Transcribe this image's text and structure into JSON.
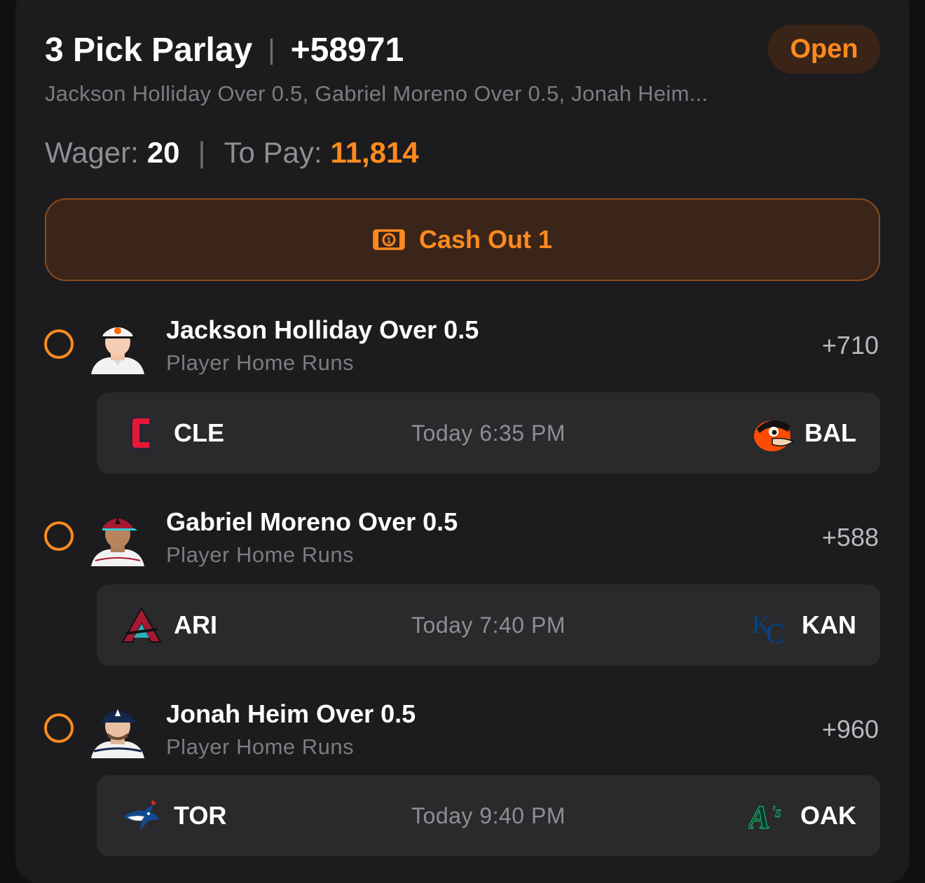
{
  "parlay": {
    "title": "3 Pick Parlay",
    "separator": "|",
    "odds": "+58971",
    "status": "Open",
    "picks_summary": "Jackson Holliday Over 0.5, Gabriel Moreno Over 0.5, Jonah Heim...",
    "wager_label": "Wager:",
    "wager_value": "20",
    "to_pay_label": "To Pay:",
    "to_pay_value": "11,814",
    "cash_out_label": "Cash Out 1"
  },
  "legs": [
    {
      "pick": "Jackson Holliday Over 0.5",
      "market": "Player Home Runs",
      "odds": "+710",
      "home": {
        "abbr": "CLE",
        "logo": "guardians-c-logo"
      },
      "time": "Today 6:35 PM",
      "away": {
        "abbr": "BAL",
        "logo": "orioles-bird-logo"
      }
    },
    {
      "pick": "Gabriel Moreno Over 0.5",
      "market": "Player Home Runs",
      "odds": "+588",
      "home": {
        "abbr": "ARI",
        "logo": "diamondbacks-a-logo"
      },
      "time": "Today 7:40 PM",
      "away": {
        "abbr": "KAN",
        "logo": "royals-kc-logo"
      }
    },
    {
      "pick": "Jonah Heim Over 0.5",
      "market": "Player Home Runs",
      "odds": "+960",
      "home": {
        "abbr": "TOR",
        "logo": "blue-jays-logo"
      },
      "time": "Today 9:40 PM",
      "away": {
        "abbr": "OAK",
        "logo": "athletics-logo"
      }
    }
  ],
  "colors": {
    "accent": "#ff8a1f",
    "card_bg": "#1c1c1e",
    "game_bg": "#2a2a2d"
  }
}
